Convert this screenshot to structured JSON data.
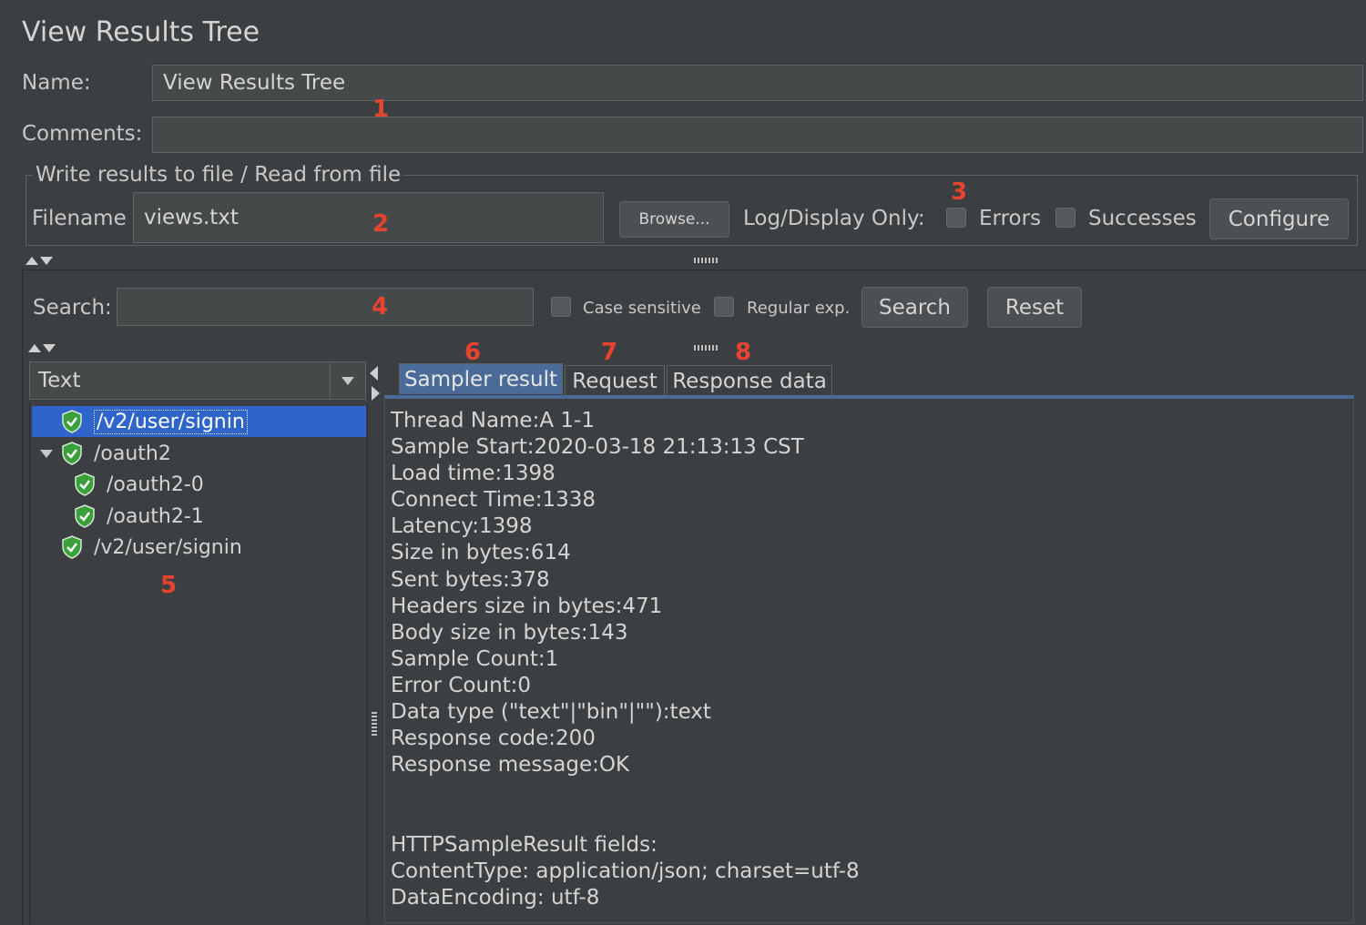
{
  "window": {
    "title": "View Results Tree"
  },
  "form": {
    "name_label": "Name:",
    "name_value": "View Results Tree",
    "comments_label": "Comments:",
    "comments_value": ""
  },
  "file_panel": {
    "legend": "Write results to file / Read from file",
    "filename_label": "Filename",
    "filename_value": "views.txt",
    "browse_label": "Browse...",
    "log_display_label": "Log/Display Only:",
    "errors_label": "Errors",
    "successes_label": "Successes",
    "configure_label": "Configure"
  },
  "search_bar": {
    "label": "Search:",
    "value": "",
    "case_sensitive_label": "Case sensitive",
    "regex_label": "Regular exp.",
    "search_button": "Search",
    "reset_button": "Reset"
  },
  "renderer": {
    "selected": "Text"
  },
  "tree": [
    {
      "label": "/v2/user/signin",
      "selected": true,
      "depth": 0,
      "expandable": false
    },
    {
      "label": "/oauth2",
      "selected": false,
      "depth": 0,
      "expandable": true,
      "expanded": true
    },
    {
      "label": "/oauth2-0",
      "selected": false,
      "depth": 1,
      "expandable": false
    },
    {
      "label": "/oauth2-1",
      "selected": false,
      "depth": 1,
      "expandable": false
    },
    {
      "label": "/v2/user/signin",
      "selected": false,
      "depth": 0,
      "expandable": false
    }
  ],
  "tabs": [
    {
      "label": "Sampler result",
      "active": true
    },
    {
      "label": "Request",
      "active": false
    },
    {
      "label": "Response data",
      "active": false
    }
  ],
  "sampler_result": [
    "Thread Name:A 1-1",
    "Sample Start:2020-03-18 21:13:13 CST",
    "Load time:1398",
    "Connect Time:1338",
    "Latency:1398",
    "Size in bytes:614",
    "Sent bytes:378",
    "Headers size in bytes:471",
    "Body size in bytes:143",
    "Sample Count:1",
    "Error Count:0",
    "Data type (\"text\"|\"bin\"|\"\"):text",
    "Response code:200",
    "Response message:OK",
    "",
    "",
    "HTTPSampleResult fields:",
    "ContentType: application/json; charset=utf-8",
    "DataEncoding: utf-8"
  ],
  "annotations": [
    "1",
    "2",
    "3",
    "4",
    "5",
    "6",
    "7",
    "8"
  ],
  "colors": {
    "background": "#3c3f41",
    "selection": "#2f65ca",
    "tab_active": "#4a6b97",
    "annotation": "#e8432f",
    "shield": "#3aa13a"
  }
}
